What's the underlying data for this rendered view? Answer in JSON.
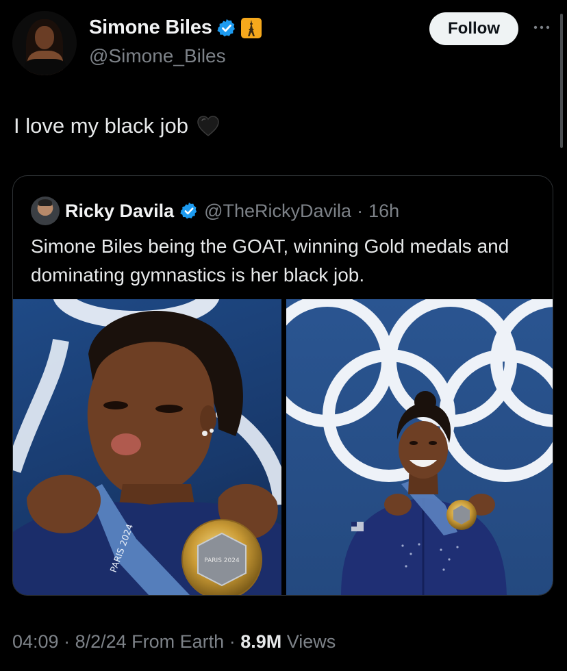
{
  "author": {
    "name": "Simone Biles",
    "handle": "@Simone_Biles",
    "verified_icon": "verified-badge-icon",
    "affiliation_icon": "eiffel-tower-icon",
    "follow_label": "Follow",
    "more_icon": "more-dots-icon"
  },
  "tweet": {
    "text": "I love my black job",
    "emoji": "black-heart-icon"
  },
  "quote": {
    "name": "Ricky Davila",
    "handle": "@TheRickyDavila",
    "separator": "·",
    "time": "16h",
    "text": "Simone Biles being the GOAT, winning Gold medals and dominating gymnastics is her black job.",
    "left_photo_medal_text": "PARIS 2024",
    "left_photo_lanyard_text": "PARIS 2024"
  },
  "footer": {
    "time": "04:09",
    "sep1": " · ",
    "date": "8/2/24",
    "source": " From Earth",
    "sep2": " · ",
    "views_count": "8.9M",
    "views_label": " Views"
  },
  "colors": {
    "background": "#000000",
    "text": "#e7e9ea",
    "muted": "#7d8288",
    "verified": "#1d9bf0",
    "affiliation": "#f5a81c",
    "follow_button": "#eff3f4"
  }
}
